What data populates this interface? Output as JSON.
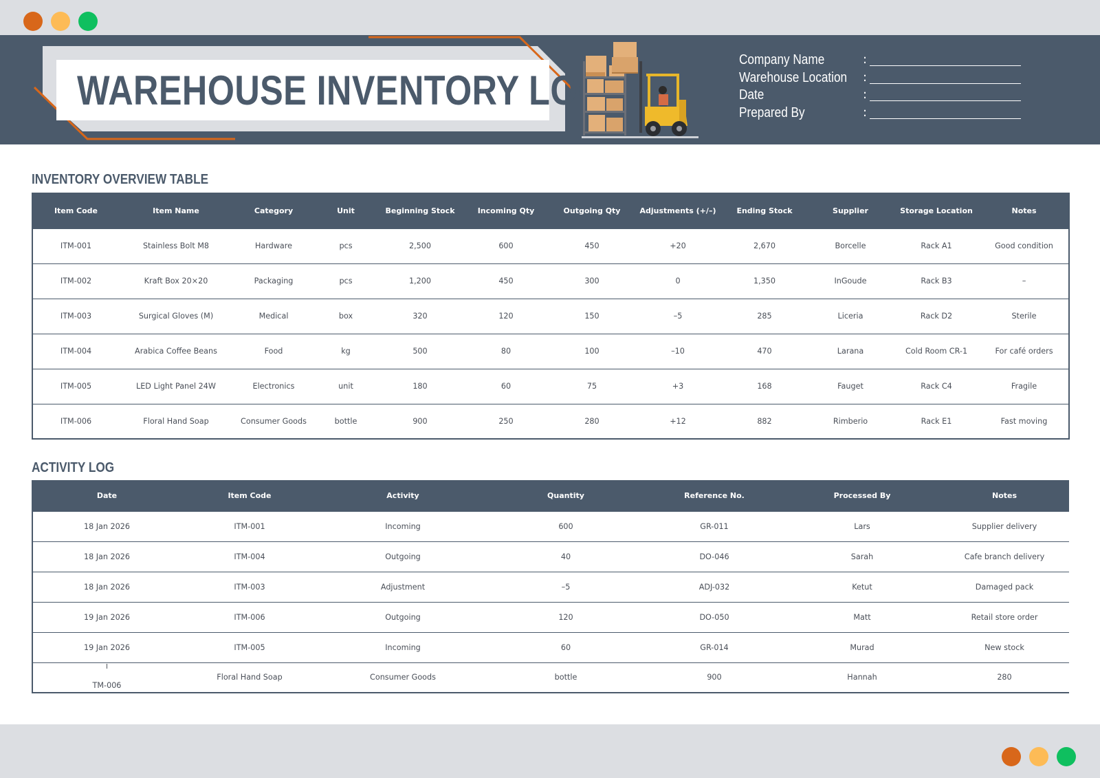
{
  "title": "WAREHOUSE INVENTORY LOG",
  "colors": {
    "banner": "#4b5a6b",
    "accent_orange": "#d8671a",
    "accent_yellow": "#fdbb56",
    "accent_green": "#0fbf5f",
    "frame_gray": "#dcdee2"
  },
  "meta_fields": [
    {
      "label": "Company Name",
      "colon": ":"
    },
    {
      "label": "Warehouse Location",
      "colon": ":"
    },
    {
      "label": "Date",
      "colon": ":"
    },
    {
      "label": "Prepared By",
      "colon": ":"
    }
  ],
  "inventory": {
    "title": "INVENTORY OVERVIEW TABLE",
    "headers": [
      "Item Code",
      "Item Name",
      "Category",
      "Unit",
      "Beginning Stock",
      "Incoming Qty",
      "Outgoing Qty",
      "Adjustments (+/–)",
      "Ending Stock",
      "Supplier",
      "Storage Location",
      "Notes"
    ],
    "rows": [
      [
        "ITM-001",
        "Stainless Bolt M8",
        "Hardware",
        "pcs",
        "2,500",
        "600",
        "450",
        "+20",
        "2,670",
        "Borcelle",
        "Rack A1",
        "Good condition"
      ],
      [
        "ITM-002",
        "Kraft Box 20×20",
        "Packaging",
        "pcs",
        "1,200",
        "450",
        "300",
        "0",
        "1,350",
        "InGoude",
        "Rack B3",
        "–"
      ],
      [
        "ITM-003",
        "Surgical Gloves (M)",
        "Medical",
        "box",
        "320",
        "120",
        "150",
        "–5",
        "285",
        "Liceria",
        "Rack D2",
        "Sterile"
      ],
      [
        "ITM-004",
        "Arabica Coffee Beans",
        "Food",
        "kg",
        "500",
        "80",
        "100",
        "–10",
        "470",
        "Larana",
        "Cold Room CR-1",
        "For café orders"
      ],
      [
        "ITM-005",
        "LED Light Panel 24W",
        "Electronics",
        "unit",
        "180",
        "60",
        "75",
        "+3",
        "168",
        "Fauget",
        "Rack C4",
        "Fragile"
      ],
      [
        "ITM-006",
        "Floral Hand Soap",
        "Consumer Goods",
        "bottle",
        "900",
        "250",
        "280",
        "+12",
        "882",
        "Rimberio",
        "Rack E1",
        "Fast moving"
      ]
    ]
  },
  "activity": {
    "title": "ACTIVITY LOG",
    "headers": [
      "Date",
      "Item Code",
      "Activity",
      "Quantity",
      "Reference No.",
      "Processed By",
      "Notes"
    ],
    "rows": [
      [
        "18 Jan 2026",
        "ITM-001",
        "Incoming",
        "600",
        "GR-011",
        "Lars",
        "Supplier delivery"
      ],
      [
        "18 Jan 2026",
        "ITM-004",
        "Outgoing",
        "40",
        "DO-046",
        "Sarah",
        "Cafe branch delivery"
      ],
      [
        "18 Jan 2026",
        "ITM-003",
        "Adjustment",
        "–5",
        "ADJ-032",
        "Ketut",
        "Damaged pack"
      ],
      [
        "19 Jan 2026",
        "ITM-006",
        "Outgoing",
        "120",
        "DO-050",
        "Matt",
        "Retail store order"
      ],
      [
        "19 Jan 2026",
        "ITM-005",
        "Incoming",
        "60",
        "GR-014",
        "Murad",
        "New stock"
      ]
    ],
    "last_row": {
      "tick": "I",
      "first": "TM-006",
      "cells": [
        "Floral Hand Soap",
        "Consumer Goods",
        "bottle",
        "900",
        "Hannah",
        "280"
      ]
    }
  }
}
